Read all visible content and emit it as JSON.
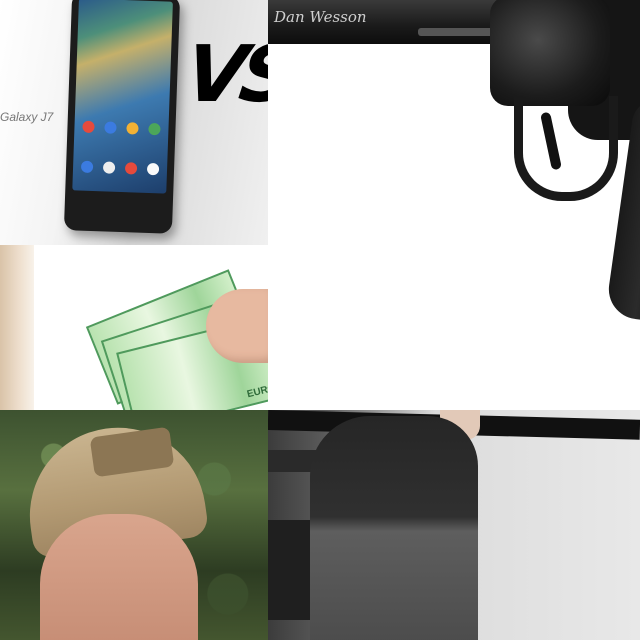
{
  "tiles": {
    "phones": {
      "galaxy_text": "Galaxy J7",
      "vs_text": "VS"
    },
    "revolver": {
      "engraving": "Dan Wesson"
    },
    "money": {
      "note_text": "EURO"
    },
    "cap_person": {},
    "sweater_person": {}
  }
}
